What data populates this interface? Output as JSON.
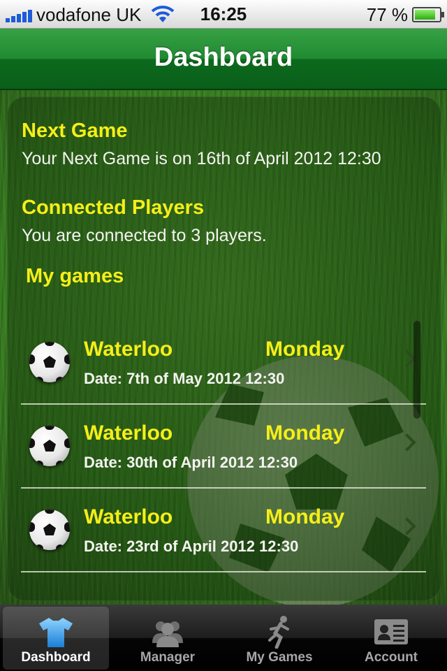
{
  "status_bar": {
    "carrier": "vodafone UK",
    "time": "16:25",
    "battery": "77 %"
  },
  "nav": {
    "title": "Dashboard"
  },
  "dashboard": {
    "next_game": {
      "heading": "Next Game",
      "text": "Your Next Game is on 16th of April 2012 12:30"
    },
    "connected_players": {
      "heading": "Connected Players",
      "text": "You are connected to 3 players."
    },
    "my_games_heading": "My games",
    "games": [
      {
        "title": "Waterloo",
        "day": "Monday",
        "date": "Date: 7th of May 2012 12:30"
      },
      {
        "title": "Waterloo",
        "day": "Monday",
        "date": "Date: 30th of April 2012 12:30"
      },
      {
        "title": "Waterloo",
        "day": "Monday",
        "date": "Date: 23rd of April 2012 12:30"
      }
    ]
  },
  "tabs": [
    {
      "label": "Dashboard",
      "icon": "shirt-icon",
      "active": true
    },
    {
      "label": "Manager",
      "icon": "people-icon",
      "active": false
    },
    {
      "label": "My Games",
      "icon": "runner-icon",
      "active": false
    },
    {
      "label": "Account",
      "icon": "id-card-icon",
      "active": false
    }
  ],
  "colors": {
    "accent_yellow": "#f5ef18",
    "nav_green": "#1f8a31",
    "active_tab_icon": "#3aa6ea"
  }
}
